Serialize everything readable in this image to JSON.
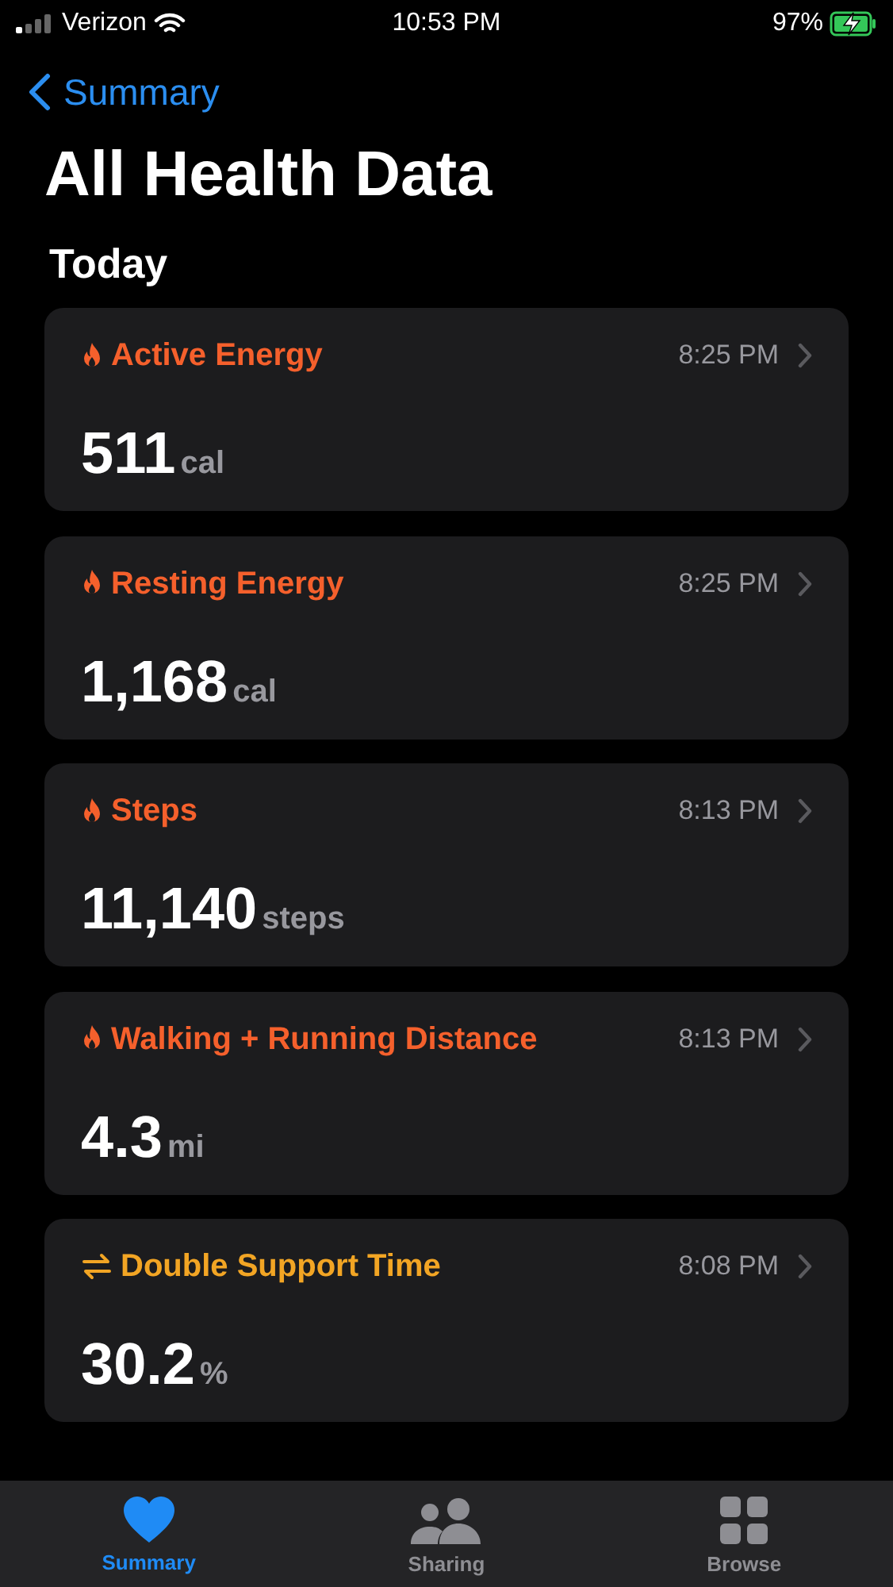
{
  "status_bar": {
    "carrier": "Verizon",
    "time": "10:53 PM",
    "battery": "97%",
    "charging": true
  },
  "nav": {
    "back": "Summary"
  },
  "title": "All Health Data",
  "section": "Today",
  "cards": [
    {
      "kind": "flame",
      "color": "#f5602c",
      "title": "Active Energy",
      "time": "8:25 PM",
      "value": "511",
      "unit": "cal"
    },
    {
      "kind": "flame",
      "color": "#f5602c",
      "title": "Resting Energy",
      "time": "8:25 PM",
      "value": "1,168",
      "unit": "cal"
    },
    {
      "kind": "flame",
      "color": "#f5602c",
      "title": "Steps",
      "time": "8:13 PM",
      "value": "11,140",
      "unit": "steps"
    },
    {
      "kind": "flame",
      "color": "#f5602c",
      "title": "Walking + Running Distance",
      "time": "8:13 PM",
      "value": "4.3",
      "unit": "mi"
    },
    {
      "kind": "arrows",
      "color": "#f2a524",
      "title": "Double Support Time",
      "time": "8:08 PM",
      "value": "30.2",
      "unit": "%"
    }
  ],
  "tab_bar": [
    {
      "kind": "heart",
      "label": "Summary",
      "selected": true
    },
    {
      "kind": "people",
      "label": "Sharing",
      "selected": false
    },
    {
      "kind": "grid",
      "label": "Browse",
      "selected": false
    }
  ]
}
